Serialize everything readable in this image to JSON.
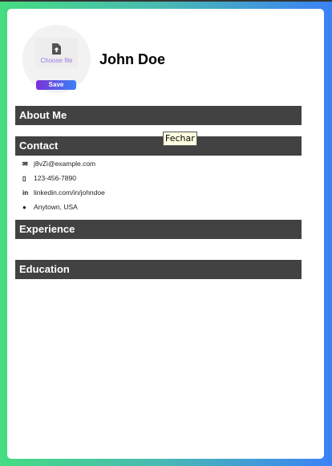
{
  "profile": {
    "name": "John Doe",
    "choose_file": "Choose file",
    "save_label": "Save"
  },
  "sections": {
    "about": "About Me",
    "contact": "Contact",
    "experience": "Experience",
    "education": "Education"
  },
  "contact": {
    "email": "j8vZi@example.com",
    "phone": "123-456-7890",
    "linkedin": "linkedin.com/in/johndoe",
    "location": "Anytown, USA",
    "linkedin_icon_text": "in"
  },
  "tooltip": "Fechar",
  "colors": {
    "section_bg": "#424242",
    "save_start": "#7c2fd6",
    "save_end": "#3b82f6"
  }
}
